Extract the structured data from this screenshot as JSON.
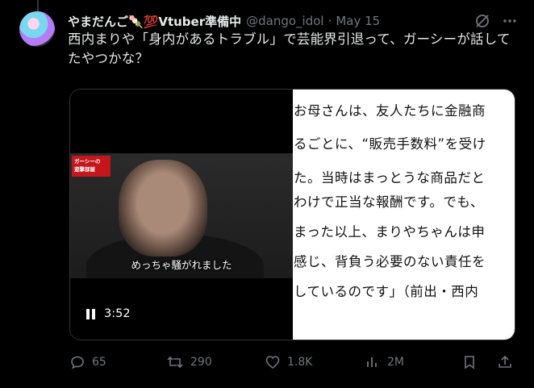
{
  "tweet": {
    "display_name": "やまだんご🍡💯Vtuber準備中",
    "handle": "@dango_idol",
    "separator": "·",
    "date": "May 15",
    "text": "西内まりや「身内があるトラブル」で芸能界引退って、ガーシーが話してたやつかな？"
  },
  "video": {
    "badge_text": "ガーシーの\n遊撃部屋",
    "subtitle": "めっちゃ騒がれました",
    "time": "3:52"
  },
  "article": {
    "lines": [
      "お母さんは、友人たちに金融商",
      "るごとに、“販売手数料”を受け",
      "た。当時はまっとうな商品だと",
      "わけで正当な報酬です。でも、",
      "まった以上、まりやちゃんは申",
      "感じ、背負う必要のない責任を",
      "しているのです」（前出・西内"
    ]
  },
  "actions": {
    "replies": "65",
    "retweets": "290",
    "likes": "1.8K",
    "views": "2M"
  }
}
